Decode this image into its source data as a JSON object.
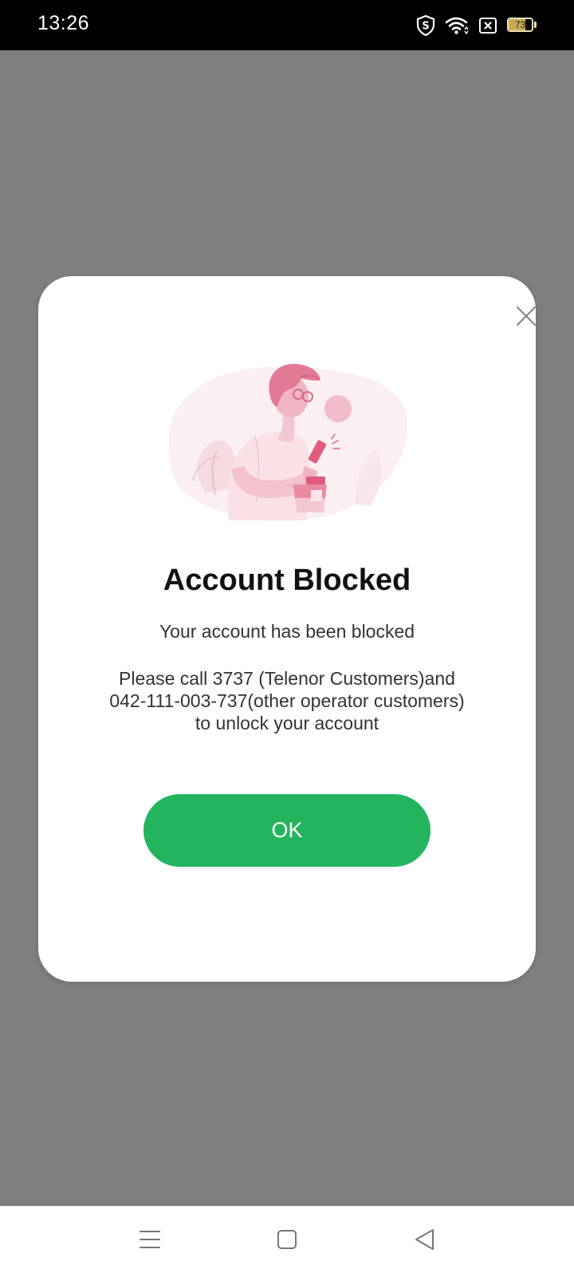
{
  "status_bar": {
    "time": "13:26",
    "icons": [
      "shield-s-icon",
      "wifi-icon",
      "no-sim-icon",
      "battery-icon"
    ],
    "battery_level": "73",
    "battery_fraction": 0.73,
    "battery_color": "#c9a94f"
  },
  "dialog": {
    "close_icon": "close-icon",
    "illustration": "person-with-phone-illustration",
    "title": "Account Blocked",
    "subtitle": "Your account has been blocked",
    "message_lines": [
      "Please call 3737 (Telenor Customers)and",
      "042-111-003-737(other operator customers)",
      "to unlock your account"
    ],
    "ok_label": "OK",
    "ok_color": "#24b45e"
  },
  "nav_bar": {
    "icons": [
      "menu-icon",
      "home-icon",
      "back-icon"
    ]
  },
  "colors": {
    "overlay": "#7f7f7f",
    "accent": "#24b45e",
    "illustration_pink": "#e98aa0"
  }
}
